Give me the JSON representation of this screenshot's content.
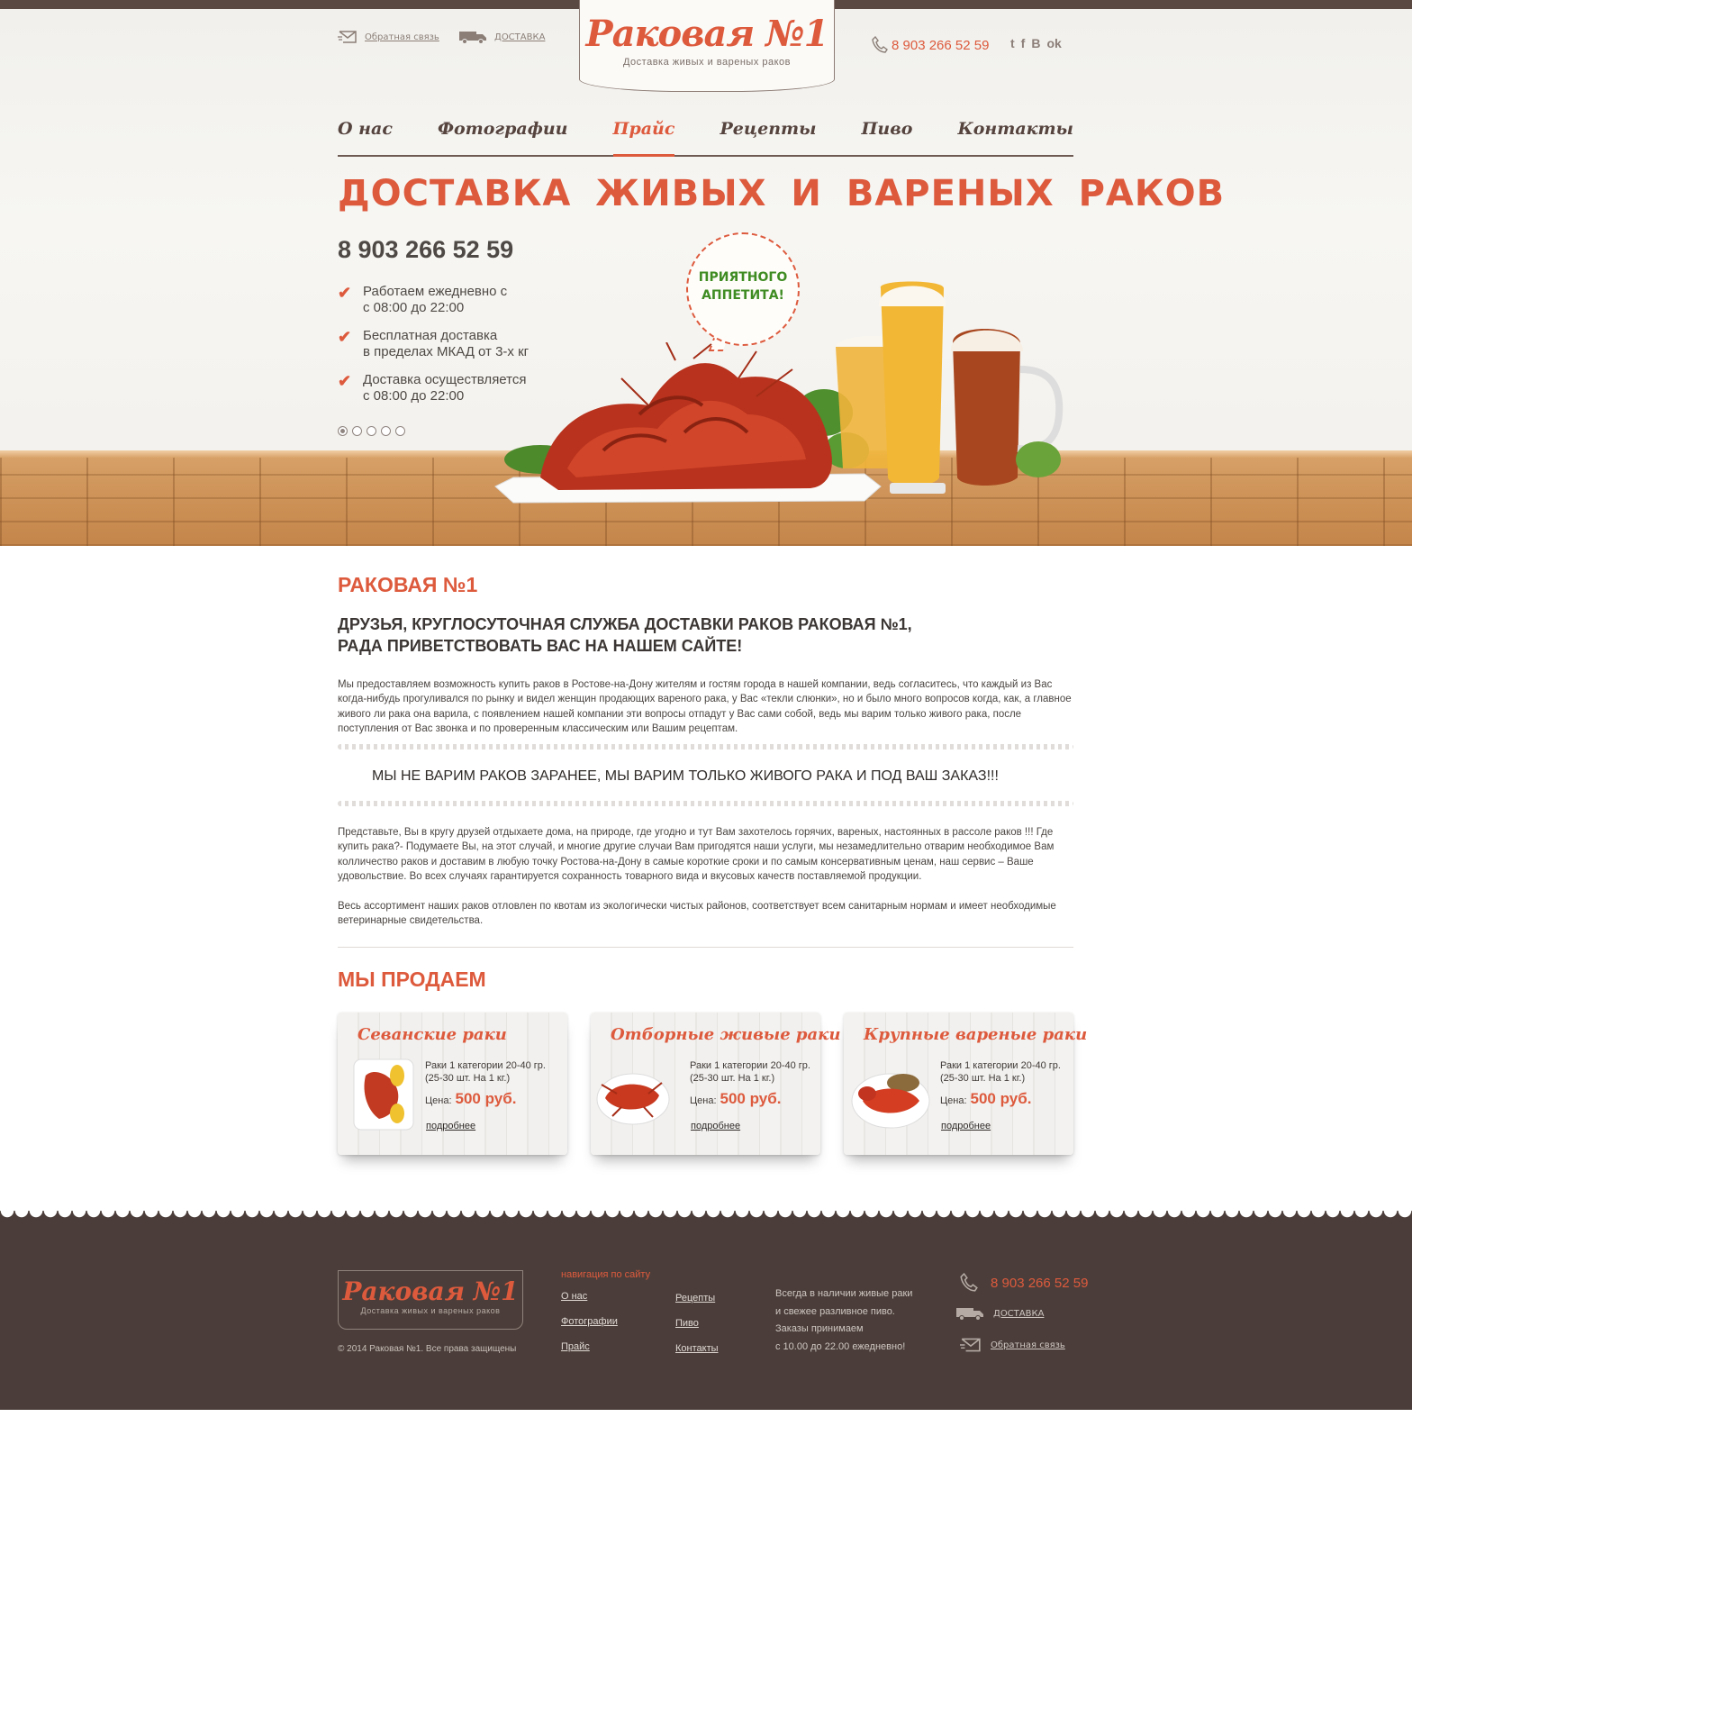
{
  "header": {
    "feedback_label": "Обратная связь",
    "delivery_label": "ДОСТАВКА",
    "logo_title": "Раковая №1",
    "logo_sub": "Доставка живых и вареных раков",
    "phone": "8 903 266 52 59",
    "social": [
      {
        "icon": "twitter-icon",
        "glyph": "t"
      },
      {
        "icon": "facebook-icon",
        "glyph": "f"
      },
      {
        "icon": "vk-icon",
        "glyph": "B"
      },
      {
        "icon": "odnoklassniki-icon",
        "glyph": "ok"
      }
    ]
  },
  "nav": {
    "items": [
      "О нас",
      "Фотографии",
      "Прайс",
      "Рецепты",
      "Пиво",
      "Контакты"
    ],
    "active_index": 2
  },
  "hero": {
    "title": "ДОСТАВКА ЖИВЫХ И ВАРЕНЫХ РАКОВ",
    "phone": "8 903 266 52 59",
    "features": [
      "Работаем ежедневно с\nс 08:00 до 22:00",
      "Бесплатная доставка\nв пределах МКАД от 3-х кг",
      "Доставка осуществляется\nс 08:00 до 22:00"
    ],
    "bubble_text": "ПРИЯТНОГО\nАППЕТИТА!",
    "slides_count": 5,
    "active_slide": 0
  },
  "about": {
    "heading": "РАКОВАЯ №1",
    "intro": "ДРУЗЬЯ, КРУГЛОСУТОЧНАЯ СЛУЖБА ДОСТАВКИ РАКОВ РАКОВАЯ №1,\nРАДА ПРИВЕТСТВОВАТЬ ВАС НА НАШЕМ САЙТЕ!",
    "paragraph1": "Мы  предоставляем возможность купить раков в Ростове-на-Дону жителям и гостям города в нашей компании, ведь согласитесь, что каждый из Вас когда-нибудь прогуливался по рынку и видел женщин продающих вареного рака, у Вас «текли слюнки», но и было много вопросов когда, как, а главное живого ли рака она варила, с появлением нашей компании эти вопросы отпадут у Вас сами собой, ведь мы варим только живого рака, после поступления от Вас звонка и по проверенным классическим или Вашим рецептам.",
    "slogan": "МЫ НЕ ВАРИМ РАКОВ ЗАРАНЕЕ, МЫ ВАРИМ ТОЛЬКО ЖИВОГО РАКА И ПОД ВАШ ЗАКАЗ!!!",
    "paragraph2": "Представьте, Вы в кругу друзей отдыхаете дома, на природе, где угодно и тут Вам захотелось горячих, вареных, настоянных в рассоле раков !!! Где купить рака?- Подумаете Вы, на этот случай, и многие другие случаи Вам пригодятся наши услуги, мы незамедлительно отварим необходимое Вам колличество раков и доставим в любую точку Ростова-на-Дону в самые короткие сроки и по самым консервативным ценам, наш сервис – Ваше удовольствие.  Во всех случаях гарантируется сохранность товарного вида и вкусовых качеств поставляемой продукции.",
    "paragraph3": "Весь ассортимент наших раков отловлен по квотам из экологически чистых районов, соответствует всем санитарным нормам и имеет необходимые ветеринарные свидетельства."
  },
  "products": {
    "heading": "МЫ ПРОДАЕМ",
    "items": [
      {
        "title": "Севанские раки",
        "desc": "Раки 1 категории 20-40 гр.\n(25-30 шт. На 1 кг.)",
        "price_label": "Цена:",
        "price": "500 руб.",
        "more": "подробнее"
      },
      {
        "title": "Отборные живые раки",
        "desc": "Раки 1 категории 20-40 гр.\n(25-30 шт. На 1 кг.)",
        "price_label": "Цена:",
        "price": "500 руб.",
        "more": "подробнее"
      },
      {
        "title": "Крупные вареные раки",
        "desc": "Раки 1 категории 20-40 гр.\n(25-30 шт. На 1 кг.)",
        "price_label": "Цена:",
        "price": "500 руб.",
        "more": "подробнее"
      }
    ]
  },
  "footer": {
    "logo_title": "Раковая №1",
    "logo_sub": "Доставка живых и вареных раков",
    "copyright": "© 2014 Раковая №1. Все права защищены",
    "nav_heading": "навигация по сайту",
    "nav_col1": [
      "О нас",
      "Фотографии",
      "Прайс"
    ],
    "nav_col2": [
      "Рецепты",
      "Пиво",
      "Контакты"
    ],
    "info": "Всегда в наличии живые раки\nи свежее разливное пиво.\nЗаказы принимаем\nс 10.00 до 22.00 ежедневно!",
    "phone": "8 903 266 52 59",
    "delivery_label": "ДОСТАВКА",
    "feedback_label": "Обратная связь"
  },
  "colors": {
    "accent": "#dd5a3d",
    "dark": "#4b3e3a",
    "topbar": "#5a4843",
    "green": "#3f8c23"
  }
}
